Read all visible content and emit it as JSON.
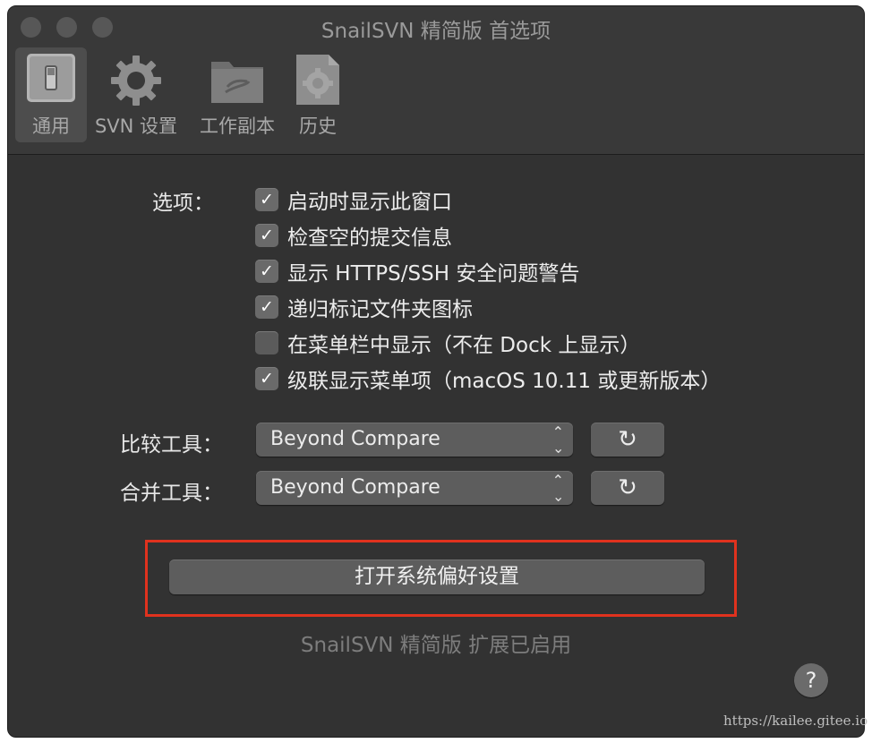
{
  "window": {
    "title": "SnailSVN 精简版 首选项"
  },
  "toolbar": {
    "items": [
      {
        "label": "通用",
        "icon": "switch-icon",
        "active": true
      },
      {
        "label": "SVN 设置",
        "icon": "gear-icon",
        "active": false
      },
      {
        "label": "工作副本",
        "icon": "folder-icon",
        "active": false
      },
      {
        "label": "历史",
        "icon": "history-gear-icon",
        "active": false
      }
    ]
  },
  "options": {
    "label": "选项：",
    "items": [
      {
        "label": "启动时显示此窗口",
        "checked": true
      },
      {
        "label": "检查空的提交信息",
        "checked": true
      },
      {
        "label": "显示 HTTPS/SSH 安全问题警告",
        "checked": true
      },
      {
        "label": "递归标记文件夹图标",
        "checked": true
      },
      {
        "label": "在菜单栏中显示（不在 Dock 上显示）",
        "checked": false
      },
      {
        "label": "级联显示菜单项（macOS 10.11 或更新版本）",
        "checked": true
      }
    ]
  },
  "diff_tool": {
    "label": "比较工具：",
    "value": "Beyond Compare",
    "refresh_icon": "refresh-icon"
  },
  "merge_tool": {
    "label": "合并工具：",
    "value": "Beyond Compare",
    "refresh_icon": "refresh-icon"
  },
  "system_prefs_button": {
    "label": "打开系统偏好设置"
  },
  "status": {
    "text": "SnailSVN 精简版 扩展已启用"
  },
  "help": {
    "label": "?"
  },
  "watermark": {
    "text": "https://kailee.gitee.io"
  },
  "colors": {
    "highlight": "#e0321e",
    "background": "#323232",
    "checkbox": "#6a6a6a"
  }
}
